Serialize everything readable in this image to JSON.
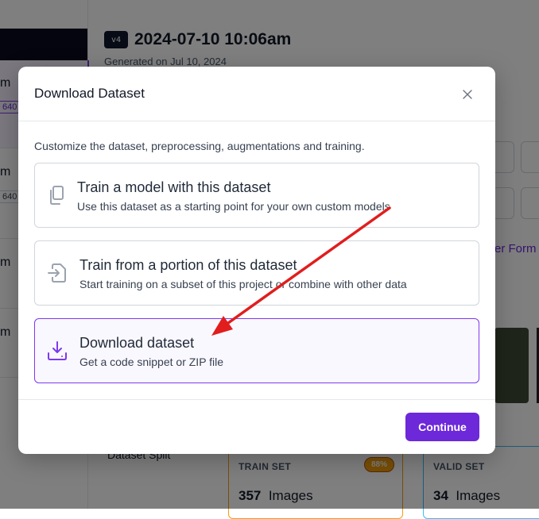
{
  "background": {
    "version_badge": "v4",
    "version_title": "2024-07-10 10:06am",
    "generated_on": "Generated on Jul 10, 2024",
    "left_items": [
      "m",
      "m",
      "m",
      "m"
    ],
    "left_chips": [
      "640",
      "640"
    ],
    "other_formats_link": "er Form",
    "dataset_split_label": "Dataset Split",
    "train_set": {
      "label": "TRAIN SET",
      "percent": "88%",
      "count": "357",
      "unit": "Images"
    },
    "valid_set": {
      "label": "VALID SET",
      "count": "34",
      "unit": "Images"
    }
  },
  "modal": {
    "title": "Download Dataset",
    "close_icon": "close-icon",
    "subtitle": "Customize the dataset, preprocessing, augmentations and training.",
    "options": [
      {
        "icon": "copy-icon",
        "title": "Train a model with this dataset",
        "description": "Use this dataset as a starting point for your own custom models",
        "selected": false
      },
      {
        "icon": "import-file-icon",
        "title": "Train from a portion of this dataset",
        "description": "Start training on a subset of this project or combine with other data",
        "selected": false
      },
      {
        "icon": "download-tray-icon",
        "title": "Download dataset",
        "description": "Get a code snippet or ZIP file",
        "selected": true
      }
    ],
    "continue_label": "Continue"
  },
  "colors": {
    "accent": "#6d28d9",
    "selected_border": "#7c3aed",
    "annotation_arrow": "#e11d1d",
    "train_badge": "#f59e0b",
    "valid_border": "#38bdf8"
  }
}
